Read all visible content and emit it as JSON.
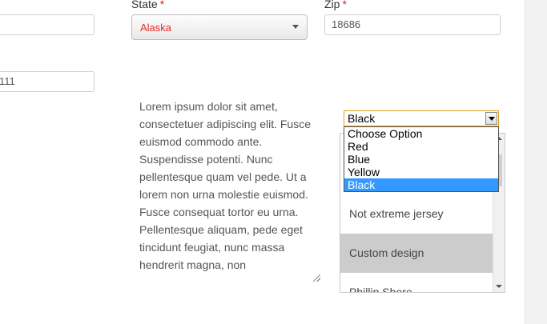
{
  "labels": {
    "state": "State",
    "zip": "Zip",
    "required_mark": "*"
  },
  "fields": {
    "left_top_value": "",
    "left_second_value": "111",
    "state_selected": "Alaska",
    "zip_value": "18686"
  },
  "notes": {
    "text": "Lorem ipsum dolor sit amet, consectetuer adipiscing elit. Fusce euismod commodo ante. Suspendisse potenti. Nunc pellentesque quam vel pede. Ut a lorem non urna molestie euismod. Fusce consequat tortor eu urna. Pellentesque aliquam, pede eget tincidunt feugiat, nunc massa hendrerit magna, non"
  },
  "color_select": {
    "selected": "Black",
    "options": [
      "Choose Option",
      "Red",
      "Blue",
      "Yellow",
      "Black"
    ]
  },
  "design_list": {
    "items": [
      "Not extreme jersey",
      "Custom design",
      "Phillip Shore"
    ],
    "highlighted_item": "Custom design"
  },
  "colors": {
    "required": "#e02020",
    "state_text": "#e03030",
    "option_highlight": "#3399ff",
    "list_highlight": "#cccccc",
    "select_focus_border": "#e0a020"
  }
}
